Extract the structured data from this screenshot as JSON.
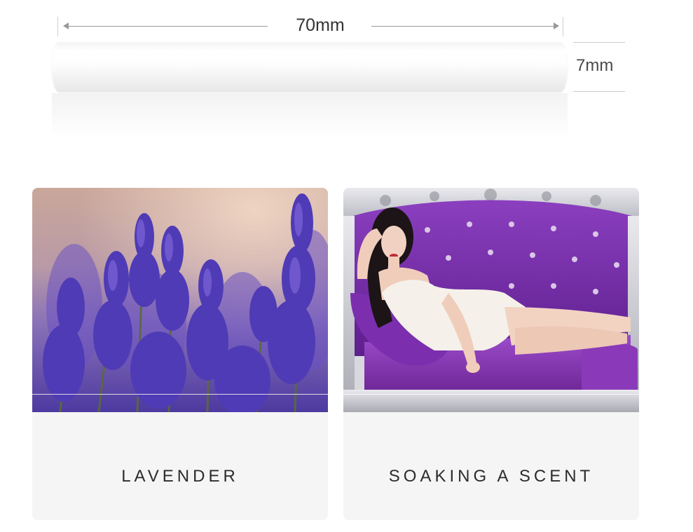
{
  "dimensions": {
    "width_label": "70mm",
    "height_label": "7mm"
  },
  "cards": [
    {
      "caption": "LAVENDER",
      "image": "lavender-field-photo"
    },
    {
      "caption": "SOAKING A SCENT",
      "image": "woman-on-purple-sofa-photo"
    }
  ],
  "colors": {
    "lavender": "#5a43b0",
    "sofa_purple": "#7a2fa8",
    "caption_bg": "#f5f5f5",
    "text": "#2c2c2c"
  }
}
